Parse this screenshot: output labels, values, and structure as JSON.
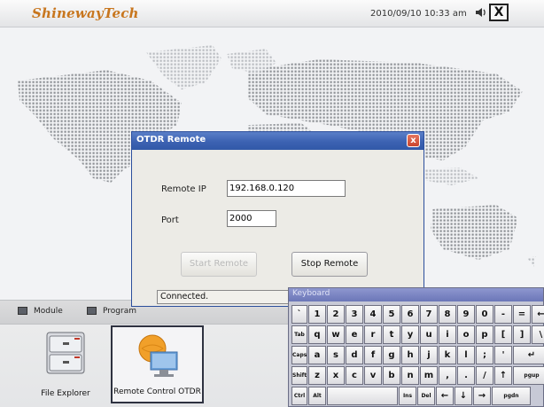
{
  "topbar": {
    "brand": "ShinewayTech",
    "datetime": "2010/09/10 10:33 am",
    "speaker_icon": "speaker-icon",
    "exit_label": "X"
  },
  "dialog": {
    "title": "OTDR Remote",
    "close_label": "x",
    "remote_ip_label": "Remote IP",
    "remote_ip_value": "192.168.0.120",
    "port_label": "Port",
    "port_value": "2000",
    "start_button": "Start Remote",
    "stop_button": "Stop Remote",
    "status": "Connected."
  },
  "tabs": [
    {
      "label": "Module",
      "icon": "module-icon"
    },
    {
      "label": "Program",
      "icon": "program-icon"
    }
  ],
  "launchers": [
    {
      "label": "File Explorer",
      "icon": "file-cabinet-icon"
    },
    {
      "label": "Remote Control OTDR",
      "icon": "monitor-globe-icon"
    }
  ],
  "keyboard": {
    "title": "Keyboard",
    "rows": [
      [
        "`",
        "1",
        "2",
        "3",
        "4",
        "5",
        "6",
        "7",
        "8",
        "9",
        "0",
        "-",
        "=",
        "←"
      ],
      [
        "Tab",
        "q",
        "w",
        "e",
        "r",
        "t",
        "y",
        "u",
        "i",
        "o",
        "p",
        "[",
        "]",
        "\\"
      ],
      [
        "Caps",
        "a",
        "s",
        "d",
        "f",
        "g",
        "h",
        "j",
        "k",
        "l",
        ";",
        "'",
        "↵"
      ],
      [
        "Shift",
        "z",
        "x",
        "c",
        "v",
        "b",
        "n",
        "m",
        ",",
        ".",
        "/",
        "↑",
        "pgup"
      ],
      [
        "Ctrl",
        "Alt",
        "",
        "Ins",
        "Del",
        "←",
        "↓",
        "→",
        "pgdn"
      ]
    ]
  },
  "colors": {
    "brand": "#c8761e",
    "dialog_title": "#3c62b2",
    "close_button": "#d0513a",
    "keyboard_title": "#7b86c4"
  }
}
